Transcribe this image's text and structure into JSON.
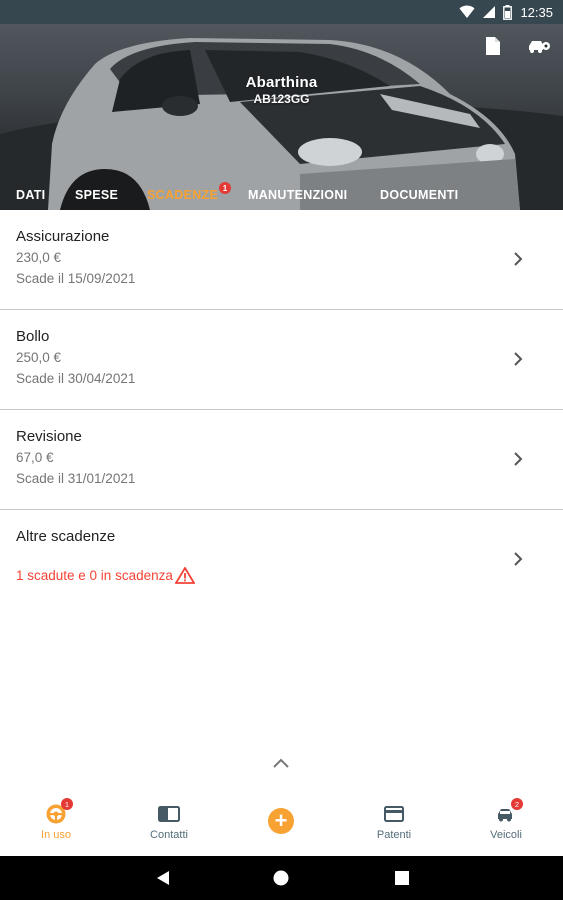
{
  "status_bar": {
    "time": "12:35"
  },
  "vehicle": {
    "name": "Abarthina",
    "plate": "AB123GG"
  },
  "header_actions": [
    {
      "icon": "document-icon"
    },
    {
      "icon": "car-settings-icon"
    }
  ],
  "tabs": [
    {
      "label": "DATI",
      "active": false
    },
    {
      "label": "SPESE",
      "active": false
    },
    {
      "label": "SCADENZE",
      "active": true,
      "badge": "1"
    },
    {
      "label": "MANUTENZIONI",
      "active": false
    },
    {
      "label": "DOCUMENTI",
      "active": false
    }
  ],
  "deadlines": [
    {
      "title": "Assicurazione",
      "amount": "230,0 €",
      "expiry": "Scade il 15/09/2021"
    },
    {
      "title": "Bollo",
      "amount": "250,0 €",
      "expiry": "Scade il 30/04/2021"
    },
    {
      "title": "Revisione",
      "amount": "67,0 €",
      "expiry": "Scade il 31/01/2021"
    }
  ],
  "other_deadlines": {
    "title": "Altre scadenze",
    "summary": "1 scadute e 0 in scadenza"
  },
  "bottom_nav": [
    {
      "label": "In uso",
      "icon": "steering-wheel-icon",
      "active": true,
      "badge": "1"
    },
    {
      "label": "Contatti",
      "icon": "contacts-icon",
      "active": false
    },
    {
      "label": "",
      "icon": "add-icon",
      "active": false
    },
    {
      "label": "Patenti",
      "icon": "license-card-icon",
      "active": false
    },
    {
      "label": "Veicoli",
      "icon": "vehicles-icon",
      "active": false,
      "badge": "2"
    }
  ],
  "colors": {
    "accent": "#f7a232",
    "alert": "#e53935",
    "warning_text": "#f44336",
    "muted_text": "#757575"
  }
}
